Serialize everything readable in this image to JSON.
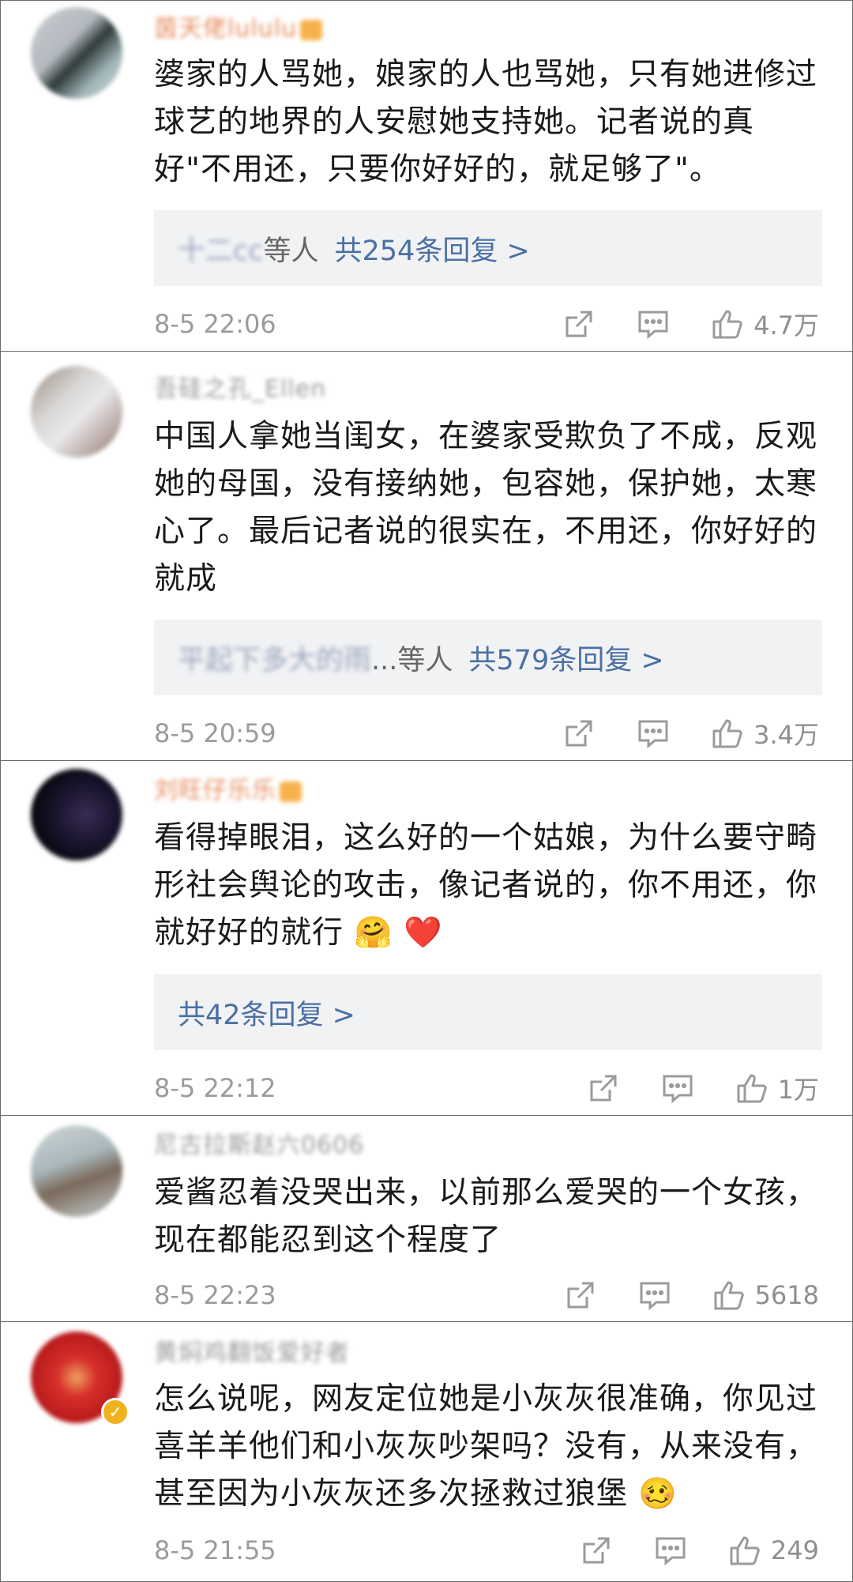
{
  "comments": [
    {
      "username": "茵天佬lululu",
      "content": "婆家的人骂她，娘家的人也骂她，只有她进修过球艺的地界的人安慰她支持她。记者说的真好\"不用还，只要你好好的，就足够了\"。",
      "repliers": "十二cc",
      "etal": "等人",
      "reply_count": "共254条回复 >",
      "time": "8-5 22:06",
      "likes": "4.7万"
    },
    {
      "username": "吾硅之孔_Ellen",
      "content": "中国人拿她当闺女，在婆家受欺负了不成，反观她的母国，没有接纳她，包容她，保护她，太寒心了。最后记者说的很实在，不用还，你好好的就成",
      "repliers": "平起下多大的雨",
      "etal": "...等人",
      "reply_count": "共579条回复 >",
      "time": "8-5 20:59",
      "likes": "3.4万"
    },
    {
      "username": "刘旺仔乐乐",
      "content": "看得掉眼泪，这么好的一个姑娘，为什么要守畸形社会舆论的攻击，像记者说的，你不用还，你就好好的就行",
      "emojis": "🤗 ❤️",
      "reply_count": "共42条回复 >",
      "time": "8-5 22:12",
      "likes": "1万"
    },
    {
      "username": "尼古拉斯赵六0606",
      "content": "爱酱忍着没哭出来，以前那么爱哭的一个女孩，现在都能忍到这个程度了",
      "time": "8-5 22:23",
      "likes": "5618"
    },
    {
      "username": "黄焖鸡翻饭爱好者",
      "content": "怎么说呢，网友定位她是小灰灰很准确，你见过喜羊羊他们和小灰灰吵架吗？没有，从来没有，甚至因为小灰灰还多次拯救过狼堡",
      "emojis": "🥴",
      "time": "8-5 21:55",
      "likes": "249"
    }
  ],
  "icons": {
    "share": "share-icon",
    "comment": "comment-icon",
    "like": "like-icon"
  }
}
